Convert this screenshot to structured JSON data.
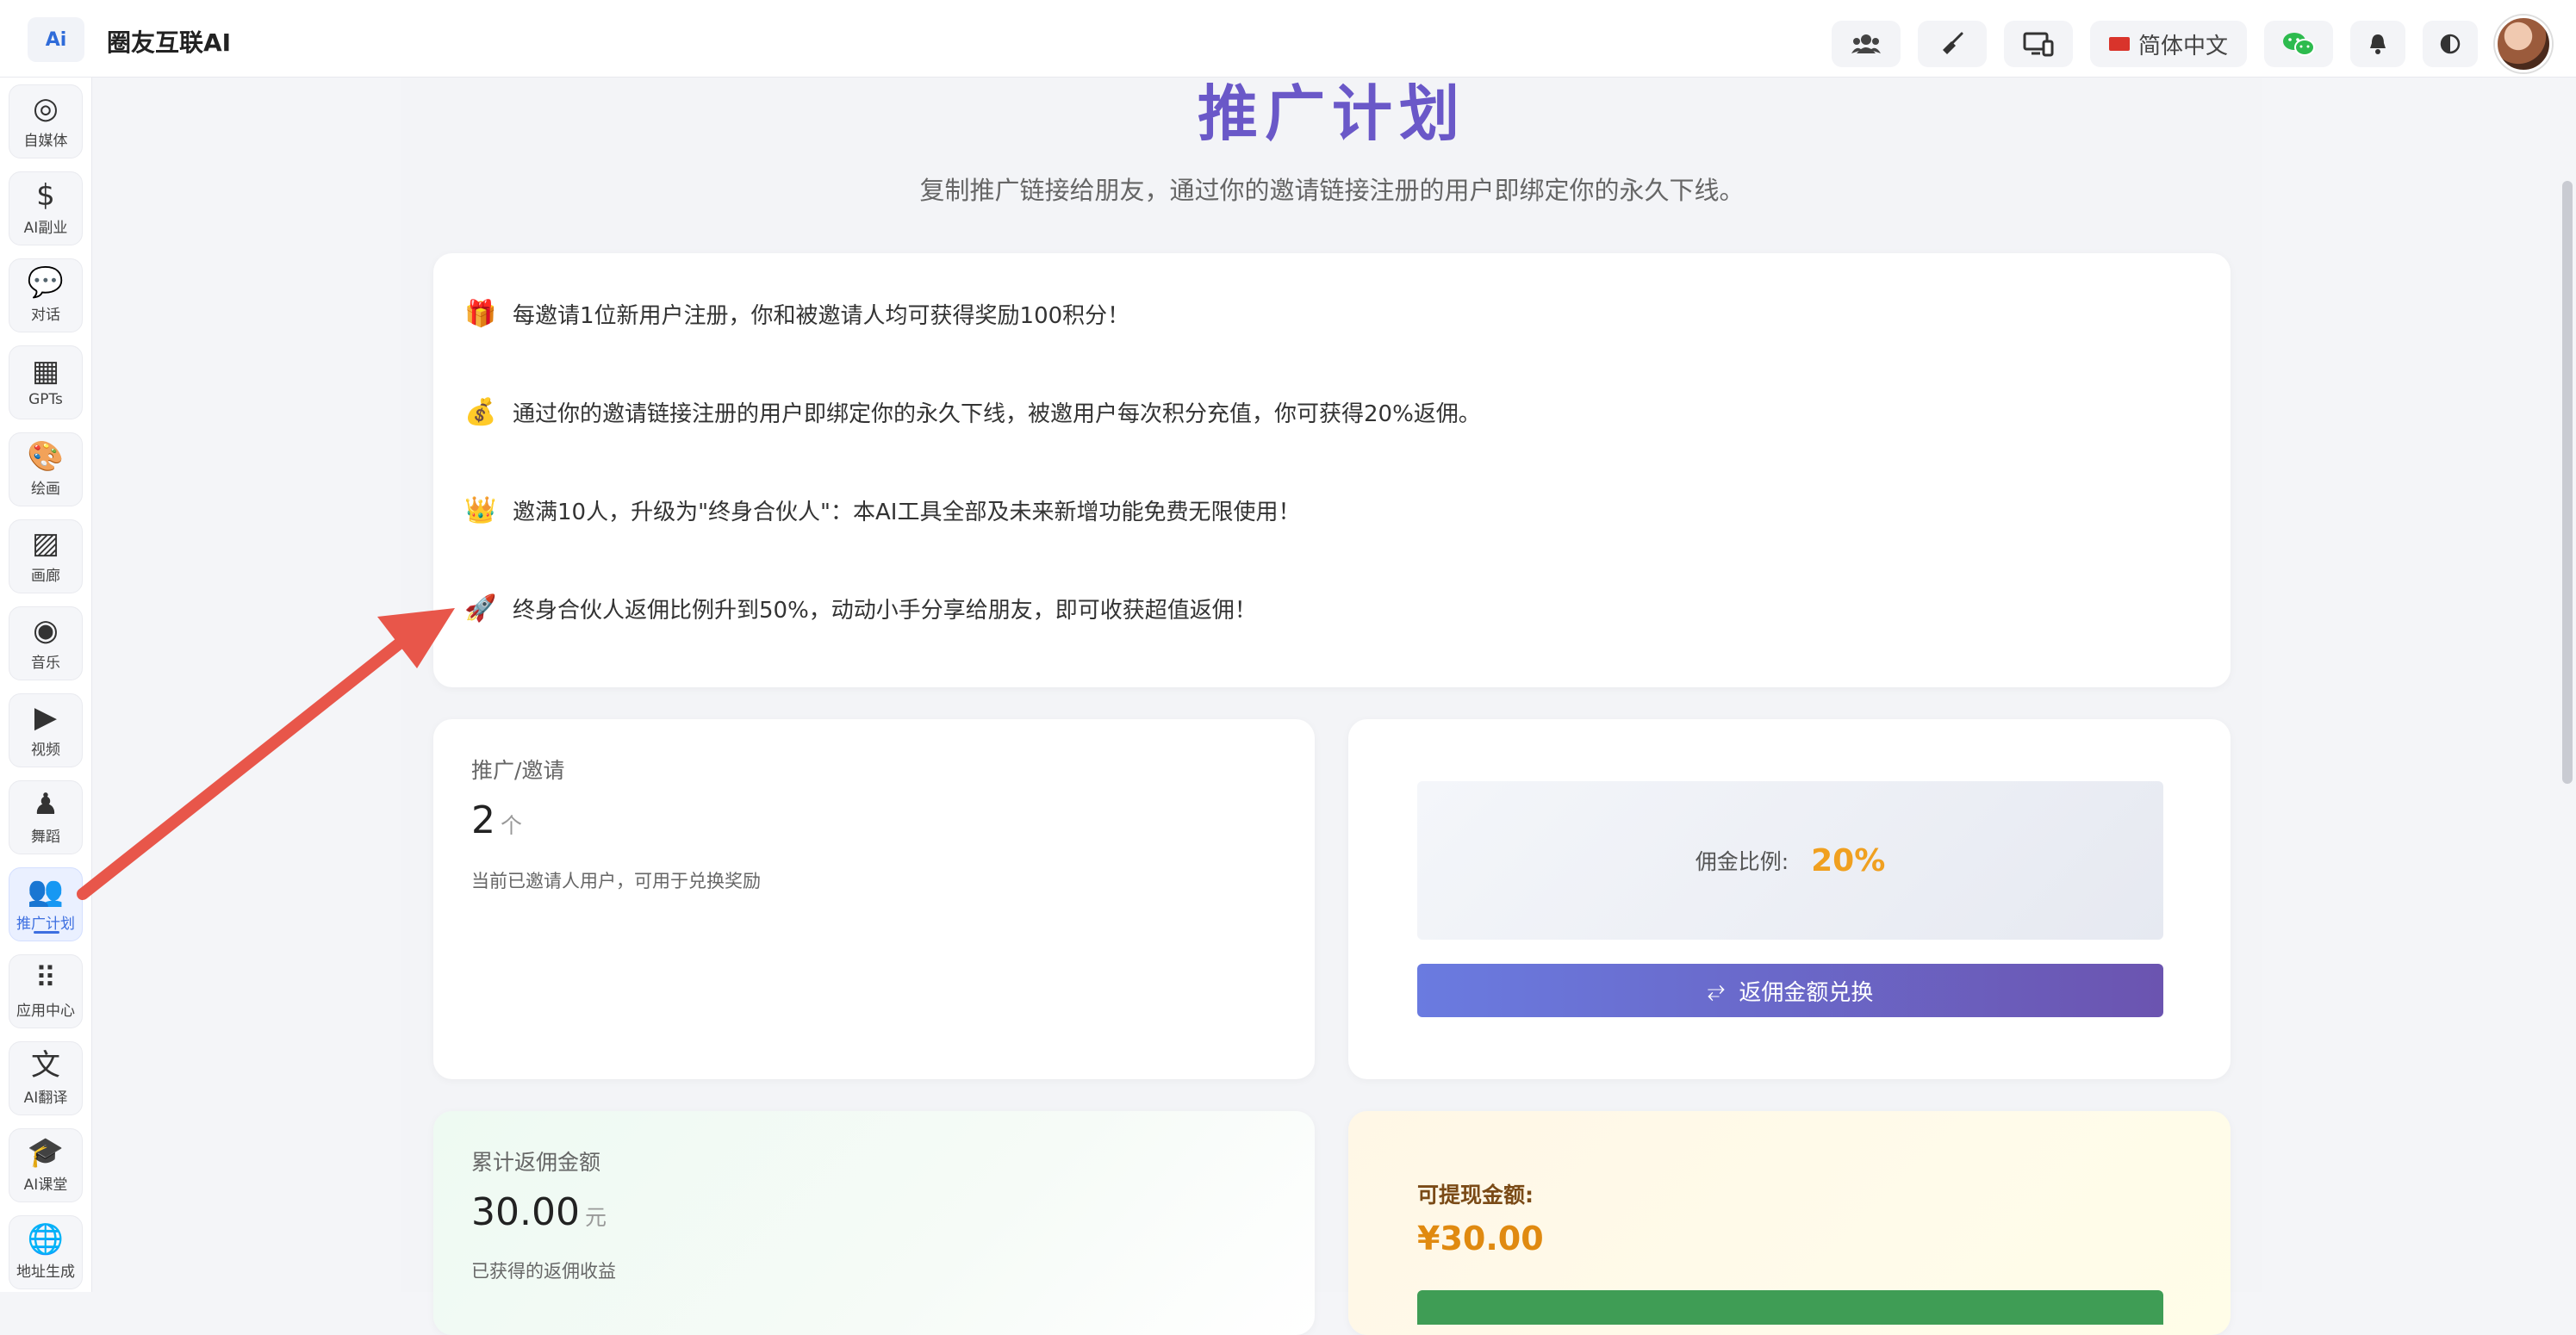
{
  "header": {
    "logo_text": "Ai",
    "app_title": "圈友互联AI",
    "language": "简体中文",
    "icons": [
      "users-icon",
      "broom-icon",
      "monitor-icon",
      "flag-icon",
      "wechat-icon",
      "bell-icon",
      "theme-toggle-icon",
      "avatar"
    ]
  },
  "sidebar": {
    "items": [
      {
        "label": "自媒体",
        "icon": "broadcast-icon",
        "glyph": "◎"
      },
      {
        "label": "AI副业",
        "icon": "dollar-icon",
        "glyph": "$"
      },
      {
        "label": "对话",
        "icon": "chat-icon",
        "glyph": "💬"
      },
      {
        "label": "GPTs",
        "icon": "store-icon",
        "glyph": "▦"
      },
      {
        "label": "绘画",
        "icon": "palette-icon",
        "glyph": "🎨"
      },
      {
        "label": "画廊",
        "icon": "image-icon",
        "glyph": "▨"
      },
      {
        "label": "音乐",
        "icon": "music-icon",
        "glyph": "◉"
      },
      {
        "label": "视频",
        "icon": "video-icon",
        "glyph": "▶"
      },
      {
        "label": "舞蹈",
        "icon": "dance-icon",
        "glyph": "♟"
      },
      {
        "label": "推广计划",
        "icon": "promotion-users-icon",
        "glyph": "👥",
        "active": true
      },
      {
        "label": "应用中心",
        "icon": "apps-grid-icon",
        "glyph": "⠿"
      },
      {
        "label": "AI翻译",
        "icon": "translate-icon",
        "glyph": "文"
      },
      {
        "label": "AI课堂",
        "icon": "graduation-cap-icon",
        "glyph": "🎓"
      },
      {
        "label": "地址生成",
        "icon": "globe-icon",
        "glyph": "🌐"
      }
    ]
  },
  "main": {
    "title": "推广计划",
    "subtitle": "复制推广链接给朋友，通过你的邀请链接注册的用户即绑定你的永久下线。",
    "benefits": [
      {
        "emoji": "🎁",
        "icon": "gift-icon",
        "text": "每邀请1位新用户注册，你和被邀请人均可获得奖励100积分！"
      },
      {
        "emoji": "💰",
        "icon": "money-bag-icon",
        "text": "通过你的邀请链接注册的用户即绑定你的永久下线，被邀用户每次积分充值，你可获得20%返佣。"
      },
      {
        "emoji": "👑",
        "icon": "crown-icon",
        "text": "邀满10人，升级为\"终身合伙人\"：本AI工具全部及未来新增功能免费无限使用！"
      },
      {
        "emoji": "🚀",
        "icon": "rocket-icon",
        "text": "终身合伙人返佣比例升到50%，动动小手分享给朋友，即可收获超值返佣！"
      }
    ],
    "invite": {
      "label": "推广/邀请",
      "count": "2",
      "unit": "个",
      "desc": "当前已邀请人用户，可用于兑换奖励"
    },
    "commission": {
      "label": "佣金比例:",
      "value": "20%",
      "button_label": "返佣金额兑换",
      "button_icon": "⥂"
    },
    "total": {
      "label": "累计返佣金额",
      "amount": "30.00",
      "unit": "元",
      "desc": "已获得的返佣收益"
    },
    "withdraw": {
      "label": "可提现金额:",
      "amount": "¥30.00"
    }
  },
  "colors": {
    "title_purple": "#6a58c8",
    "accent_blue": "#3d6fe0",
    "ratio_orange": "#f0a020",
    "arrow_red": "#e8564a"
  }
}
